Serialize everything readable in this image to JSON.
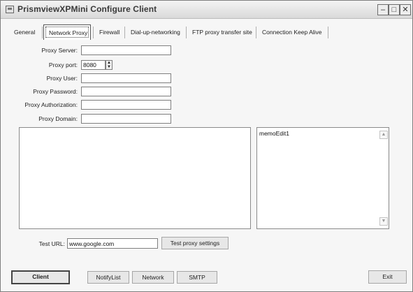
{
  "window": {
    "title": "PrismviewXPMini Configure Client"
  },
  "tabs": [
    {
      "label": "General"
    },
    {
      "label": "Network Proxy"
    },
    {
      "label": "Firewall"
    },
    {
      "label": "Dial-up-networking"
    },
    {
      "label": "FTP proxy transfer site"
    },
    {
      "label": "Connection Keep Alive"
    }
  ],
  "proxy": {
    "server_label": "Proxy Server:",
    "server_value": "",
    "port_label": "Proxy port:",
    "port_value": "8080",
    "user_label": "Proxy User:",
    "user_value": "",
    "password_label": "Proxy Password:",
    "password_value": "",
    "auth_label": "Proxy Authorization:",
    "auth_value": "",
    "domain_label": "Proxy Domain:",
    "domain_value": ""
  },
  "memo": {
    "text": "memoEdit1"
  },
  "test": {
    "url_label": "Test URL:",
    "url_value": "www.google.com",
    "button_label": "Test proxy settings"
  },
  "footer": {
    "client_label": "Client",
    "notify_label": "NotifyList",
    "network_label": "Network",
    "smtp_label": "SMTP",
    "exit_label": "Exit"
  },
  "icons": {
    "app": "app-icon",
    "minimize": "minimize-icon",
    "maximize": "maximize-icon",
    "close": "close-icon",
    "spin": "spin-updown-icon",
    "scroll_up": "scroll-up-arrow-icon",
    "scroll_down": "scroll-down-arrow-icon"
  }
}
